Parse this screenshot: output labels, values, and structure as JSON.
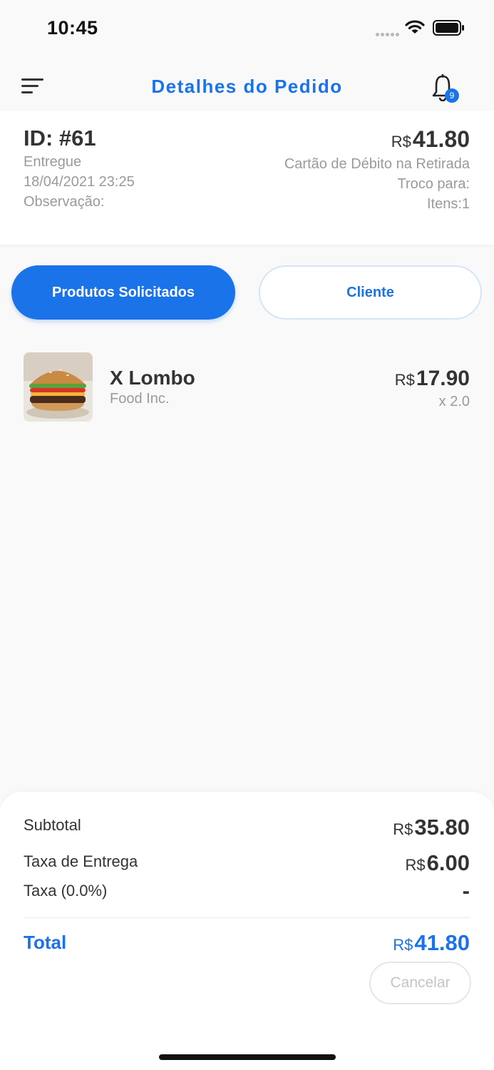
{
  "status_bar": {
    "time": "10:45"
  },
  "header": {
    "title": "Detalhes do Pedido",
    "notification_count": "9"
  },
  "order": {
    "id": "ID: #61",
    "status": "Entregue",
    "date": "18/04/2021 23:25",
    "note_label": "Observação:",
    "currency": "R$",
    "total": "41.80",
    "payment_method": "Cartão de Débito na Retirada",
    "change_label": "Troco para:",
    "items_label": "Itens:1"
  },
  "tabs": [
    {
      "label": "Produtos Solicitados",
      "active": true
    },
    {
      "label": "Cliente",
      "active": false
    }
  ],
  "products": [
    {
      "name": "X Lombo",
      "store": "Food Inc.",
      "currency": "R$",
      "price": "17.90",
      "quantity": "x 2.0"
    }
  ],
  "summary": {
    "subtotal_label": "Subtotal",
    "subtotal_currency": "R$",
    "subtotal_value": "35.80",
    "delivery_label": "Taxa de Entrega",
    "delivery_currency": "R$",
    "delivery_value": "6.00",
    "tax_label": "Taxa (0.0%)",
    "tax_value": "-",
    "total_label": "Total",
    "total_currency": "R$",
    "total_value": "41.80",
    "cancel_label": "Cancelar"
  },
  "colors": {
    "accent": "#1a73e8",
    "muted": "#9a9a9a",
    "text": "#333333"
  }
}
